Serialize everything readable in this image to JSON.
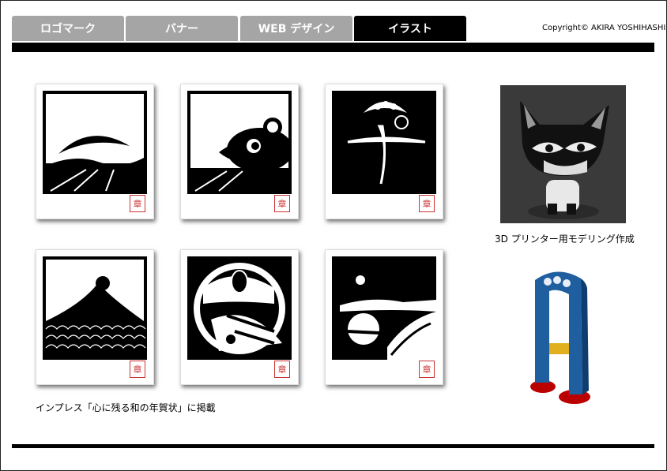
{
  "nav": {
    "tabs": [
      {
        "label": "ロゴマーク"
      },
      {
        "label": "バナー"
      },
      {
        "label": "WEB デザイン"
      },
      {
        "label": "イラスト"
      }
    ],
    "active_index": 3
  },
  "header": {
    "copyright": "Copyright© AKIRA YOSHIHASHI"
  },
  "gallery": {
    "cards": [
      {
        "icon": "moon-landscape-icon",
        "stamp": "章"
      },
      {
        "icon": "mouse-landscape-icon",
        "stamp": "章"
      },
      {
        "icon": "sun-kanji-icon",
        "stamp": "章"
      },
      {
        "icon": "mount-fuji-icon",
        "stamp": "章"
      },
      {
        "icon": "circle-scene-icon",
        "stamp": "章"
      },
      {
        "icon": "moon-cliff-icon",
        "stamp": "章"
      }
    ],
    "caption": "インプレス「心に残る和の年賀状」に掲載"
  },
  "models": {
    "cat_caption": "3D プリンター用モデリング作成"
  },
  "colors": {
    "tab_inactive": "#a5a5a5",
    "tab_active": "#000000",
    "stamp": "#cc3333"
  }
}
